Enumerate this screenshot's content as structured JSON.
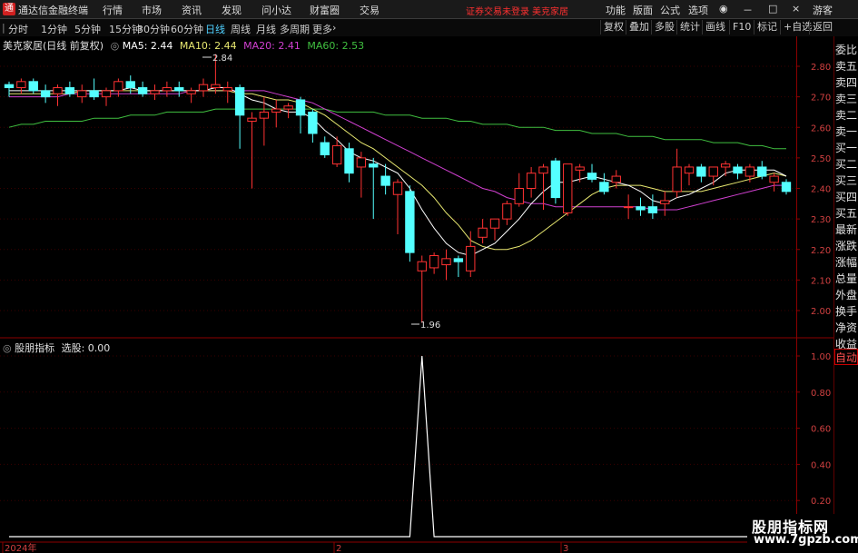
{
  "titlebar": {
    "app_title": "通达信金融终端",
    "menus": [
      "行情",
      "市场",
      "资讯",
      "发现",
      "问小达",
      "财富圈",
      "交易"
    ],
    "status_text": "证券交易未登录",
    "stock_name_header": "美克家居",
    "right_menus": [
      "功能",
      "版面",
      "公式",
      "选项"
    ],
    "user": "游客",
    "logo_glyph": "通"
  },
  "toolbar": {
    "periods": [
      "分时",
      "1分钟",
      "5分钟",
      "15分钟",
      "30分钟",
      "60分钟",
      "日线",
      "周线",
      "月线",
      "多周期",
      "更多"
    ],
    "active_period": "日线",
    "right_buttons": [
      "复权",
      "叠加",
      "多股",
      "统计",
      "画线",
      "F10",
      "标记",
      "+自选",
      "返回"
    ]
  },
  "legend": {
    "title": "美克家居(日线 前复权)",
    "ma5_label": "MA5: 2.44",
    "ma10_label": "MA10: 2.44",
    "ma20_label": "MA20: 2.41",
    "ma60_label": "MA60: 2.53",
    "high_label": "2.84",
    "low_label": "1.96"
  },
  "indicator": {
    "name": "股朋指标",
    "value_label": "选股: 0.00",
    "y_ticks": [
      "1.00",
      "0.80",
      "0.60",
      "0.40",
      "0.20"
    ]
  },
  "sidebar": {
    "items": [
      "委比",
      "卖五",
      "卖四",
      "卖三",
      "卖二",
      "卖一",
      "买一",
      "买二",
      "买三",
      "买四",
      "买五",
      "最新",
      "涨跌",
      "涨幅",
      "总量",
      "外盘",
      "换手",
      "净资",
      "收益"
    ],
    "auto_label": "自动"
  },
  "x_axis": {
    "labels": [
      "2024年",
      "2",
      "3"
    ]
  },
  "watermark": {
    "line1": "股朋指标网",
    "line2": "www.7gpzb.com"
  },
  "colors": {
    "up": "#ff3232",
    "down": "#54ffff",
    "ma5": "#ffffff",
    "ma10": "#e8e870",
    "ma20": "#d040d0",
    "ma60": "#40c040",
    "frame": "#8b0000"
  },
  "chart_data": [
    {
      "type": "candlestick",
      "title": "美克家居(日线 前复权)",
      "ylim": [
        1.9,
        2.88
      ],
      "y_ticks": [
        2.0,
        2.1,
        2.2,
        2.3,
        2.4,
        2.5,
        2.6,
        2.7,
        2.8
      ],
      "candles": [
        [
          2.74,
          2.75,
          2.7,
          2.73
        ],
        [
          2.73,
          2.76,
          2.71,
          2.75
        ],
        [
          2.75,
          2.76,
          2.71,
          2.72
        ],
        [
          2.72,
          2.74,
          2.68,
          2.7
        ],
        [
          2.71,
          2.74,
          2.67,
          2.73
        ],
        [
          2.73,
          2.75,
          2.7,
          2.71
        ],
        [
          2.7,
          2.74,
          2.68,
          2.72
        ],
        [
          2.72,
          2.76,
          2.69,
          2.7
        ],
        [
          2.7,
          2.73,
          2.67,
          2.72
        ],
        [
          2.72,
          2.76,
          2.7,
          2.75
        ],
        [
          2.75,
          2.77,
          2.71,
          2.73
        ],
        [
          2.73,
          2.75,
          2.7,
          2.71
        ],
        [
          2.71,
          2.74,
          2.69,
          2.72
        ],
        [
          2.72,
          2.75,
          2.7,
          2.73
        ],
        [
          2.73,
          2.75,
          2.7,
          2.72
        ],
        [
          2.71,
          2.73,
          2.68,
          2.72
        ],
        [
          2.72,
          2.76,
          2.7,
          2.74
        ],
        [
          2.73,
          2.84,
          2.71,
          2.74
        ],
        [
          2.72,
          2.75,
          2.68,
          2.73
        ],
        [
          2.73,
          2.74,
          2.53,
          2.64
        ],
        [
          2.62,
          2.65,
          2.4,
          2.63
        ],
        [
          2.63,
          2.7,
          2.54,
          2.65
        ],
        [
          2.65,
          2.69,
          2.6,
          2.66
        ],
        [
          2.66,
          2.68,
          2.63,
          2.67
        ],
        [
          2.69,
          2.7,
          2.58,
          2.64
        ],
        [
          2.65,
          2.66,
          2.55,
          2.58
        ],
        [
          2.55,
          2.57,
          2.5,
          2.51
        ],
        [
          2.48,
          2.57,
          2.47,
          2.54
        ],
        [
          2.53,
          2.55,
          2.42,
          2.45
        ],
        [
          2.47,
          2.52,
          2.37,
          2.5
        ],
        [
          2.48,
          2.5,
          2.3,
          2.47
        ],
        [
          2.44,
          2.48,
          2.38,
          2.41
        ],
        [
          2.38,
          2.43,
          2.25,
          2.42
        ],
        [
          2.39,
          2.41,
          2.16,
          2.19
        ],
        [
          2.13,
          2.18,
          1.96,
          2.16
        ],
        [
          2.14,
          2.19,
          2.12,
          2.18
        ],
        [
          2.15,
          2.2,
          2.1,
          2.17
        ],
        [
          2.17,
          2.18,
          2.11,
          2.16
        ],
        [
          2.13,
          2.26,
          2.11,
          2.21
        ],
        [
          2.24,
          2.3,
          2.22,
          2.27
        ],
        [
          2.27,
          2.3,
          2.23,
          2.3
        ],
        [
          2.3,
          2.36,
          2.28,
          2.35
        ],
        [
          2.35,
          2.45,
          2.34,
          2.4
        ],
        [
          2.4,
          2.47,
          2.37,
          2.45
        ],
        [
          2.45,
          2.48,
          2.33,
          2.47
        ],
        [
          2.49,
          2.5,
          2.35,
          2.37
        ],
        [
          2.32,
          2.43,
          2.31,
          2.48
        ],
        [
          2.46,
          2.48,
          2.42,
          2.47
        ],
        [
          2.45,
          2.48,
          2.42,
          2.43
        ],
        [
          2.42,
          2.45,
          2.38,
          2.39
        ],
        [
          2.42,
          2.46,
          2.4,
          2.44
        ],
        [
          2.34,
          2.38,
          2.3,
          2.34
        ],
        [
          2.34,
          2.37,
          2.31,
          2.33
        ],
        [
          2.34,
          2.38,
          2.3,
          2.32
        ],
        [
          2.35,
          2.39,
          2.31,
          2.36
        ],
        [
          2.39,
          2.53,
          2.37,
          2.47
        ],
        [
          2.45,
          2.48,
          2.41,
          2.47
        ],
        [
          2.47,
          2.48,
          2.42,
          2.44
        ],
        [
          2.44,
          2.47,
          2.41,
          2.47
        ],
        [
          2.47,
          2.49,
          2.44,
          2.48
        ],
        [
          2.47,
          2.48,
          2.43,
          2.45
        ],
        [
          2.44,
          2.48,
          2.42,
          2.47
        ],
        [
          2.47,
          2.49,
          2.43,
          2.44
        ],
        [
          2.42,
          2.45,
          2.39,
          2.44
        ],
        [
          2.42,
          2.43,
          2.38,
          2.39
        ]
      ],
      "ma5": [
        2.72,
        2.72,
        2.72,
        2.72,
        2.72,
        2.72,
        2.72,
        2.72,
        2.72,
        2.72,
        2.73,
        2.72,
        2.72,
        2.72,
        2.72,
        2.72,
        2.72,
        2.73,
        2.73,
        2.71,
        2.69,
        2.68,
        2.66,
        2.65,
        2.65,
        2.63,
        2.59,
        2.56,
        2.52,
        2.5,
        2.49,
        2.47,
        2.45,
        2.4,
        2.33,
        2.27,
        2.22,
        2.19,
        2.18,
        2.2,
        2.22,
        2.26,
        2.3,
        2.35,
        2.39,
        2.42,
        2.42,
        2.43,
        2.44,
        2.43,
        2.42,
        2.41,
        2.39,
        2.36,
        2.35,
        2.37,
        2.38,
        2.4,
        2.42,
        2.45,
        2.46,
        2.46,
        2.46,
        2.46,
        2.44
      ],
      "ma10": [
        2.71,
        2.71,
        2.71,
        2.71,
        2.71,
        2.71,
        2.72,
        2.72,
        2.72,
        2.72,
        2.72,
        2.72,
        2.72,
        2.72,
        2.72,
        2.72,
        2.72,
        2.72,
        2.72,
        2.71,
        2.71,
        2.7,
        2.69,
        2.69,
        2.68,
        2.66,
        2.64,
        2.61,
        2.58,
        2.55,
        2.53,
        2.5,
        2.47,
        2.44,
        2.41,
        2.37,
        2.32,
        2.28,
        2.23,
        2.21,
        2.2,
        2.2,
        2.21,
        2.23,
        2.26,
        2.29,
        2.32,
        2.35,
        2.38,
        2.4,
        2.41,
        2.41,
        2.41,
        2.4,
        2.39,
        2.39,
        2.39,
        2.39,
        2.4,
        2.41,
        2.42,
        2.43,
        2.44,
        2.45,
        2.44
      ],
      "ma20": [
        2.7,
        2.7,
        2.7,
        2.7,
        2.7,
        2.71,
        2.71,
        2.71,
        2.71,
        2.71,
        2.71,
        2.71,
        2.71,
        2.71,
        2.71,
        2.72,
        2.72,
        2.72,
        2.72,
        2.72,
        2.72,
        2.72,
        2.71,
        2.7,
        2.69,
        2.68,
        2.66,
        2.64,
        2.62,
        2.6,
        2.58,
        2.56,
        2.54,
        2.52,
        2.5,
        2.48,
        2.46,
        2.44,
        2.42,
        2.4,
        2.39,
        2.37,
        2.36,
        2.35,
        2.35,
        2.34,
        2.34,
        2.34,
        2.34,
        2.34,
        2.34,
        2.34,
        2.34,
        2.33,
        2.33,
        2.33,
        2.34,
        2.35,
        2.36,
        2.37,
        2.38,
        2.39,
        2.4,
        2.41,
        2.41
      ],
      "ma60": [
        2.6,
        2.61,
        2.61,
        2.62,
        2.62,
        2.62,
        2.62,
        2.63,
        2.63,
        2.63,
        2.64,
        2.64,
        2.64,
        2.65,
        2.65,
        2.65,
        2.65,
        2.66,
        2.66,
        2.66,
        2.66,
        2.66,
        2.66,
        2.66,
        2.66,
        2.66,
        2.66,
        2.65,
        2.65,
        2.65,
        2.65,
        2.64,
        2.64,
        2.64,
        2.63,
        2.63,
        2.63,
        2.62,
        2.62,
        2.61,
        2.61,
        2.61,
        2.6,
        2.6,
        2.6,
        2.59,
        2.59,
        2.59,
        2.58,
        2.58,
        2.58,
        2.57,
        2.57,
        2.57,
        2.56,
        2.56,
        2.56,
        2.56,
        2.55,
        2.55,
        2.55,
        2.54,
        2.54,
        2.53,
        2.53
      ]
    },
    {
      "type": "line",
      "title": "股朋指标",
      "ylim": [
        0,
        1.05
      ],
      "y_ticks": [
        0.2,
        0.4,
        0.6,
        0.8,
        1.0
      ],
      "values": [
        0,
        0,
        0,
        0,
        0,
        0,
        0,
        0,
        0,
        0,
        0,
        0,
        0,
        0,
        0,
        0,
        0,
        0,
        0,
        0,
        0,
        0,
        0,
        0,
        0,
        0,
        0,
        0,
        0,
        0,
        0,
        0,
        0,
        0,
        1,
        0,
        0,
        0,
        0,
        0,
        0,
        0,
        0,
        0,
        0,
        0,
        0,
        0,
        0,
        0,
        0,
        0,
        0,
        0,
        0,
        0,
        0,
        0,
        0,
        0,
        0,
        0,
        0,
        0,
        0
      ]
    }
  ]
}
